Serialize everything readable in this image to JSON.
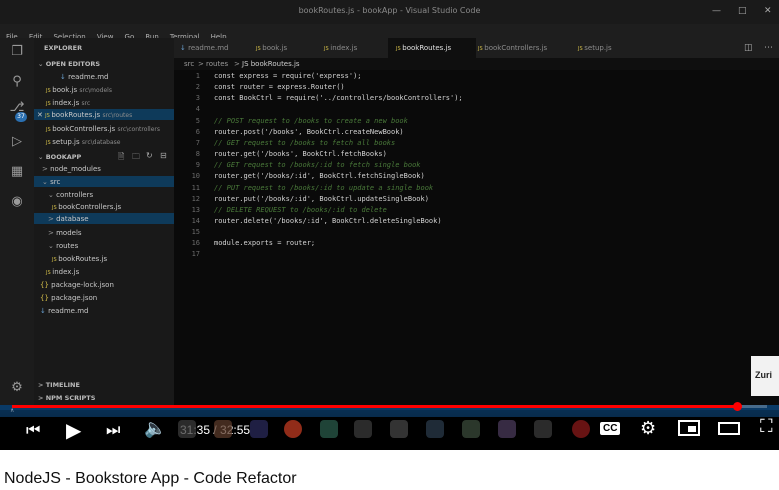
{
  "window_title": "bookRoutes.js - bookApp - Visual Studio Code",
  "menu": [
    "File",
    "Edit",
    "Selection",
    "View",
    "Go",
    "Run",
    "Terminal",
    "Help"
  ],
  "activity_icons": [
    "files-icon",
    "search-icon",
    "source-control-icon",
    "run-debug-icon",
    "extensions-icon",
    "remote-icon"
  ],
  "activity_badge": "37",
  "sidebar": {
    "explorer_label": "EXPLORER",
    "open_editors_label": "OPEN EDITORS",
    "open_editors": [
      {
        "name": "readme.md",
        "path": ""
      },
      {
        "name": "book.js",
        "path": "src\\models"
      },
      {
        "name": "index.js",
        "path": "src"
      },
      {
        "name": "bookRoutes.js",
        "path": "src\\routes"
      },
      {
        "name": "bookControllers.js",
        "path": "src\\controllers"
      },
      {
        "name": "setup.js",
        "path": "src\\database"
      }
    ],
    "project_label": "BOOKAPP",
    "tree": [
      {
        "name": "node_modules"
      },
      {
        "name": "src"
      },
      {
        "name": "controllers"
      },
      {
        "name": "bookControllers.js"
      },
      {
        "name": "database"
      },
      {
        "name": "models"
      },
      {
        "name": "routes"
      },
      {
        "name": "bookRoutes.js"
      },
      {
        "name": "index.js"
      },
      {
        "name": "package-lock.json"
      },
      {
        "name": "package.json"
      },
      {
        "name": "readme.md"
      }
    ],
    "timeline_label": "TIMELINE",
    "npm_label": "NPM SCRIPTS"
  },
  "tabs": [
    "readme.md",
    "book.js",
    "index.js",
    "bookRoutes.js",
    "bookControllers.js",
    "setup.js"
  ],
  "active_tab": "bookRoutes.js",
  "breadcrumb": [
    "src",
    ">",
    "routes",
    ">",
    "JS bookRoutes.js"
  ],
  "code_lines": [
    {
      "n": "1",
      "t": "const express = require('express');",
      "c": false
    },
    {
      "n": "2",
      "t": "const router = express.Router()",
      "c": false
    },
    {
      "n": "3",
      "t": "const BookCtrl = require('../controllers/bookControllers');",
      "c": false
    },
    {
      "n": "4",
      "t": "",
      "c": false
    },
    {
      "n": "5",
      "t": "// POST request to /books to create a new book",
      "c": true
    },
    {
      "n": "6",
      "t": "router.post('/books', BookCtrl.createNewBook)",
      "c": false
    },
    {
      "n": "7",
      "t": "// GET request to /books to fetch all books",
      "c": true
    },
    {
      "n": "8",
      "t": "router.get('/books', BookCtrl.fetchBooks)",
      "c": false
    },
    {
      "n": "9",
      "t": "// GET request to /books/:id to fetch single book",
      "c": true
    },
    {
      "n": "10",
      "t": "router.get('/books/:id', BookCtrl.fetchSingleBook)",
      "c": false
    },
    {
      "n": "11",
      "t": "// PUT request to /books/:id to update a single book",
      "c": true
    },
    {
      "n": "12",
      "t": "router.put('/books/:id', BookCtrl.updateSingleBook)",
      "c": false
    },
    {
      "n": "13",
      "t": "// DELETE REQUEST to /books/:id to delete",
      "c": true
    },
    {
      "n": "14",
      "t": "router.delete('/books/:id', BookCtrl.deleteSingleBook)",
      "c": false
    },
    {
      "n": "15",
      "t": "",
      "c": false
    },
    {
      "n": "16",
      "t": "module.exports = router;",
      "c": false
    },
    {
      "n": "17",
      "t": "",
      "c": false
    }
  ],
  "player": {
    "time": "31:35 / 32:55",
    "progress_fraction": 0.9599,
    "progress_color": "#ff0000",
    "cc_label": "CC",
    "channel_overlay": "Zuri"
  },
  "video_title": "NodeJS - Bookstore App - Code Refactor",
  "colors": {
    "status_bar": "#0a3a66",
    "selection": "#0e3a5a",
    "comment": "#4a7a3a"
  }
}
